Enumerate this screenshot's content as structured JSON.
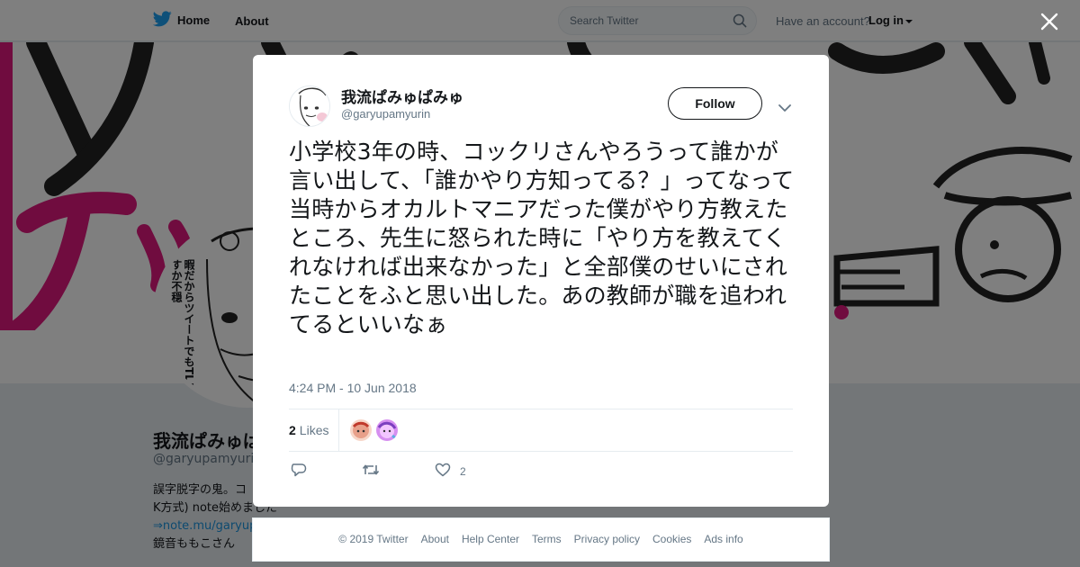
{
  "nav": {
    "home_label": "Home",
    "about_label": "About",
    "search_placeholder": "Search Twitter",
    "account_prompt": "Have an account?",
    "login_label": "Log in"
  },
  "profile": {
    "name": "我流ぱみゅぱみゅ",
    "handle": "@garyupamyurin",
    "avatar_text": "暇だからツイートでもTLに流すか不穏",
    "bio_line1": "誤字脱字の鬼。コ",
    "bio_line2": "K方式) note始めました",
    "bio_link": "⇒note.mu/garyup",
    "bio_line4": "鏡音ももこさん"
  },
  "tweet": {
    "display_name": "我流ぱみゅぱみゅ",
    "handle": "@garyupamyurin",
    "follow_label": "Follow",
    "text": "小学校3年の時、コックリさんやろうって誰かが言い出して、「誰かやり方知ってる？」ってなって当時からオカルトマニアだった僕がやり方教えたところ、先生に怒られた時に「やり方を教えてくれなければ出来なかった」と全部僕のせいにされたことをふと思い出した。あの教師が職を追われてるといいなぁ",
    "timestamp": "4:24 PM - 10 Jun 2018",
    "likes_count": "2",
    "likes_label": "Likes",
    "action_like_count": "2"
  },
  "footer": {
    "items": [
      "© 2019 Twitter",
      "About",
      "Help Center",
      "Terms",
      "Privacy policy",
      "Cookies",
      "Ads info"
    ]
  },
  "colors": {
    "accent": "#1da1f2",
    "banner_pink": "#e0187e",
    "text_primary": "#14171a",
    "text_secondary": "#657786"
  }
}
